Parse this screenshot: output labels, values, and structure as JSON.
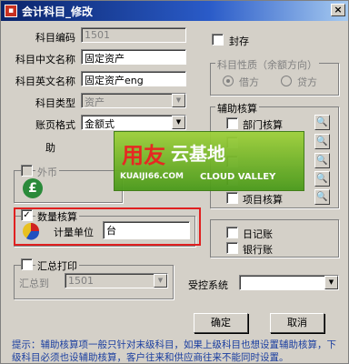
{
  "window": {
    "title": "会计科目_修改",
    "close_glyph": "×"
  },
  "form": {
    "code_label": "科目编码",
    "code_value": "1501",
    "cn_name_label": "科目中文名称",
    "cn_name_value": "固定资产",
    "en_name_label": "科目英文名称",
    "en_name_value": "固定资产eng",
    "type_label": "科目类型",
    "type_value": "资产",
    "format_label": "账页格式",
    "format_value": "金额式",
    "mnemonic_label": "助"
  },
  "seal": {
    "label": "封存"
  },
  "nature": {
    "title": "科目性质（余额方向）",
    "debit": "借方",
    "credit": "贷方",
    "selected": "借方"
  },
  "aux": {
    "title": "辅助核算",
    "items": [
      {
        "label": "部门核算"
      },
      {
        "label": ""
      },
      {
        "label": ""
      },
      {
        "label": ""
      },
      {
        "label": "项目核算"
      }
    ]
  },
  "foreign": {
    "label": "外币",
    "icon": "pound-icon",
    "glyph": "£"
  },
  "quantity": {
    "label": "数量核算",
    "checked": "✓",
    "unit_label": "计量单位",
    "unit_value": "台"
  },
  "journal": {
    "daybook": "日记账",
    "bankbook": "银行账"
  },
  "summary": {
    "label": "汇总打印",
    "to_label": "汇总到",
    "to_value": "1501"
  },
  "control": {
    "label": "受控系统",
    "value": ""
  },
  "buttons": {
    "ok": "确定",
    "cancel": "取消"
  },
  "hint": "提示：辅助核算项一般只针对末级科目，如果上级科目也想设置辅助核算，下级科目必须也设辅助核算，客户往来和供应商往来不能同时设置。",
  "watermark": {
    "brand_cn": "用友",
    "brand_cn2": "云基地",
    "domain": "KUAIJI66.COM",
    "tagline": "CLOUD VALLEY"
  },
  "colors": {
    "titlebar": "#0a246a",
    "highlight": "#e02020",
    "hint": "#1a3ea0",
    "watermark": "#4a9a1a"
  }
}
